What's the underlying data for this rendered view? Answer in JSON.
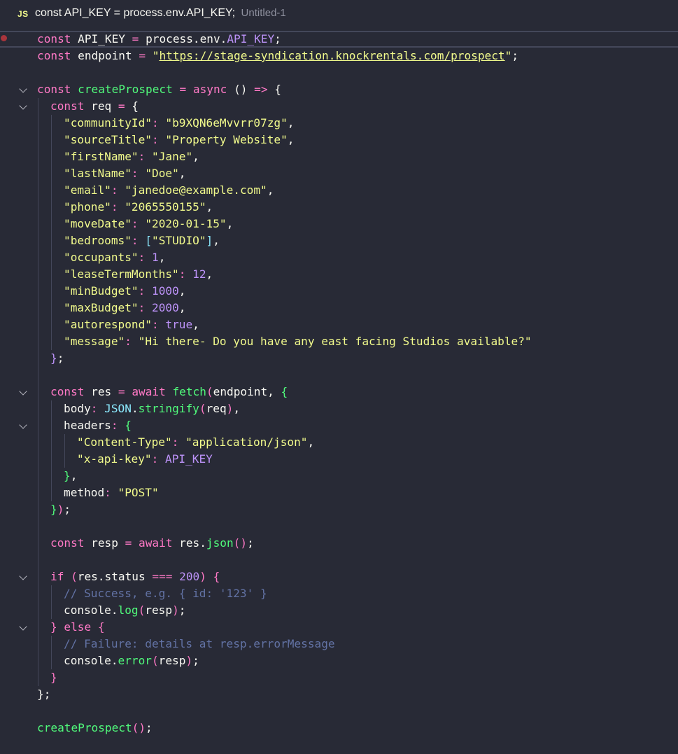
{
  "tab": {
    "badge": "JS",
    "title": "const API_KEY = process.env.API_KEY;",
    "filename": "Untitled-1"
  },
  "colors": {
    "background": "#282a36",
    "keyword": "#ff79c6",
    "string": "#f1fa8c",
    "function": "#50fa7b",
    "number": "#bd93f9",
    "comment": "#6272a4",
    "foreground": "#f8f8f2",
    "breakpoint": "#a9353c"
  },
  "editor": {
    "lines": [
      {
        "fold": false,
        "current": true,
        "indent": 0,
        "tokens": [
          [
            "k",
            "const"
          ],
          [
            "w",
            " API_KEY "
          ],
          [
            "k",
            "="
          ],
          [
            "w",
            " process.env."
          ],
          [
            "v",
            "API_KEY"
          ],
          [
            "w",
            ";"
          ]
        ]
      },
      {
        "fold": false,
        "indent": 0,
        "tokens": [
          [
            "k",
            "const"
          ],
          [
            "w",
            " endpoint "
          ],
          [
            "k",
            "="
          ],
          [
            "w",
            " "
          ],
          [
            "s",
            "\""
          ],
          [
            "u",
            "https://stage-syndication.knockrentals.com/prospect"
          ],
          [
            "s",
            "\""
          ],
          [
            "w",
            ";"
          ]
        ]
      },
      {
        "fold": false,
        "indent": 0,
        "tokens": []
      },
      {
        "fold": true,
        "indent": 0,
        "tokens": [
          [
            "k",
            "const"
          ],
          [
            "w",
            " "
          ],
          [
            "f",
            "createProspect"
          ],
          [
            "w",
            " "
          ],
          [
            "k",
            "="
          ],
          [
            "w",
            " "
          ],
          [
            "k",
            "async"
          ],
          [
            "w",
            " () "
          ],
          [
            "k",
            "=>"
          ],
          [
            "w",
            " {"
          ]
        ]
      },
      {
        "fold": true,
        "indent": 1,
        "tokens": [
          [
            "k",
            "const"
          ],
          [
            "w",
            " req "
          ],
          [
            "k",
            "="
          ],
          [
            "w",
            " {"
          ]
        ]
      },
      {
        "fold": false,
        "indent": 2,
        "tokens": [
          [
            "s",
            "\"communityId\""
          ],
          [
            "k",
            ":"
          ],
          [
            "w",
            " "
          ],
          [
            "s",
            "\"b9XQN6eMvvrr07zg\""
          ],
          [
            "w",
            ","
          ]
        ]
      },
      {
        "fold": false,
        "indent": 2,
        "tokens": [
          [
            "s",
            "\"sourceTitle\""
          ],
          [
            "k",
            ":"
          ],
          [
            "w",
            " "
          ],
          [
            "s",
            "\"Property Website\""
          ],
          [
            "w",
            ","
          ]
        ]
      },
      {
        "fold": false,
        "indent": 2,
        "tokens": [
          [
            "s",
            "\"firstName\""
          ],
          [
            "k",
            ":"
          ],
          [
            "w",
            " "
          ],
          [
            "s",
            "\"Jane\""
          ],
          [
            "w",
            ","
          ]
        ]
      },
      {
        "fold": false,
        "indent": 2,
        "tokens": [
          [
            "s",
            "\"lastName\""
          ],
          [
            "k",
            ":"
          ],
          [
            "w",
            " "
          ],
          [
            "s",
            "\"Doe\""
          ],
          [
            "w",
            ","
          ]
        ]
      },
      {
        "fold": false,
        "indent": 2,
        "tokens": [
          [
            "s",
            "\"email\""
          ],
          [
            "k",
            ":"
          ],
          [
            "w",
            " "
          ],
          [
            "s",
            "\"janedoe@example.com\""
          ],
          [
            "w",
            ","
          ]
        ]
      },
      {
        "fold": false,
        "indent": 2,
        "tokens": [
          [
            "s",
            "\"phone\""
          ],
          [
            "k",
            ":"
          ],
          [
            "w",
            " "
          ],
          [
            "s",
            "\"2065550155\""
          ],
          [
            "w",
            ","
          ]
        ]
      },
      {
        "fold": false,
        "indent": 2,
        "tokens": [
          [
            "s",
            "\"moveDate\""
          ],
          [
            "k",
            ":"
          ],
          [
            "w",
            " "
          ],
          [
            "s",
            "\"2020-01-15\""
          ],
          [
            "w",
            ","
          ]
        ]
      },
      {
        "fold": false,
        "indent": 2,
        "tokens": [
          [
            "s",
            "\"bedrooms\""
          ],
          [
            "k",
            ":"
          ],
          [
            "w",
            " "
          ],
          [
            "cy",
            "["
          ],
          [
            "s",
            "\"STUDIO\""
          ],
          [
            "cy",
            "]"
          ],
          [
            "w",
            ","
          ]
        ]
      },
      {
        "fold": false,
        "indent": 2,
        "tokens": [
          [
            "s",
            "\"occupants\""
          ],
          [
            "k",
            ":"
          ],
          [
            "w",
            " "
          ],
          [
            "v",
            "1"
          ],
          [
            "w",
            ","
          ]
        ]
      },
      {
        "fold": false,
        "indent": 2,
        "tokens": [
          [
            "s",
            "\"leaseTermMonths\""
          ],
          [
            "k",
            ":"
          ],
          [
            "w",
            " "
          ],
          [
            "v",
            "12"
          ],
          [
            "w",
            ","
          ]
        ]
      },
      {
        "fold": false,
        "indent": 2,
        "tokens": [
          [
            "s",
            "\"minBudget\""
          ],
          [
            "k",
            ":"
          ],
          [
            "w",
            " "
          ],
          [
            "v",
            "1000"
          ],
          [
            "w",
            ","
          ]
        ]
      },
      {
        "fold": false,
        "indent": 2,
        "tokens": [
          [
            "s",
            "\"maxBudget\""
          ],
          [
            "k",
            ":"
          ],
          [
            "w",
            " "
          ],
          [
            "v",
            "2000"
          ],
          [
            "w",
            ","
          ]
        ]
      },
      {
        "fold": false,
        "indent": 2,
        "tokens": [
          [
            "s",
            "\"autorespond\""
          ],
          [
            "k",
            ":"
          ],
          [
            "w",
            " "
          ],
          [
            "v",
            "true"
          ],
          [
            "w",
            ","
          ]
        ]
      },
      {
        "fold": false,
        "indent": 2,
        "tokens": [
          [
            "s",
            "\"message\""
          ],
          [
            "k",
            ":"
          ],
          [
            "w",
            " "
          ],
          [
            "s",
            "\"Hi there- Do you have any east facing Studios available?\""
          ]
        ]
      },
      {
        "fold": false,
        "indent": 1,
        "tokens": [
          [
            "v",
            "}"
          ],
          [
            "w",
            ";"
          ]
        ]
      },
      {
        "fold": false,
        "indent": 1,
        "tokens": []
      },
      {
        "fold": true,
        "indent": 1,
        "tokens": [
          [
            "k",
            "const"
          ],
          [
            "w",
            " res "
          ],
          [
            "k",
            "="
          ],
          [
            "w",
            " "
          ],
          [
            "k",
            "await"
          ],
          [
            "w",
            " "
          ],
          [
            "f",
            "fetch"
          ],
          [
            "k",
            "("
          ],
          [
            "w",
            "endpoint, "
          ],
          [
            "f",
            "{"
          ]
        ]
      },
      {
        "fold": false,
        "indent": 2,
        "tokens": [
          [
            "w",
            "body"
          ],
          [
            "k",
            ":"
          ],
          [
            "w",
            " "
          ],
          [
            "cy",
            "JSON"
          ],
          [
            "w",
            "."
          ],
          [
            "f",
            "stringify"
          ],
          [
            "k",
            "("
          ],
          [
            "w",
            "req"
          ],
          [
            "k",
            ")"
          ],
          [
            "w",
            ","
          ]
        ]
      },
      {
        "fold": true,
        "indent": 2,
        "tokens": [
          [
            "w",
            "headers"
          ],
          [
            "k",
            ":"
          ],
          [
            "w",
            " "
          ],
          [
            "f",
            "{"
          ]
        ]
      },
      {
        "fold": false,
        "indent": 3,
        "tokens": [
          [
            "s",
            "\"Content-Type\""
          ],
          [
            "k",
            ":"
          ],
          [
            "w",
            " "
          ],
          [
            "s",
            "\"application/json\""
          ],
          [
            "w",
            ","
          ]
        ]
      },
      {
        "fold": false,
        "indent": 3,
        "tokens": [
          [
            "s",
            "\"x-api-key\""
          ],
          [
            "k",
            ":"
          ],
          [
            "w",
            " "
          ],
          [
            "v",
            "API_KEY"
          ]
        ]
      },
      {
        "fold": false,
        "indent": 2,
        "tokens": [
          [
            "f",
            "}"
          ],
          [
            "w",
            ","
          ]
        ]
      },
      {
        "fold": false,
        "indent": 2,
        "tokens": [
          [
            "w",
            "method"
          ],
          [
            "k",
            ":"
          ],
          [
            "w",
            " "
          ],
          [
            "s",
            "\"POST\""
          ]
        ]
      },
      {
        "fold": false,
        "indent": 1,
        "tokens": [
          [
            "f",
            "}"
          ],
          [
            "k",
            ")"
          ],
          [
            "w",
            ";"
          ]
        ]
      },
      {
        "fold": false,
        "indent": 1,
        "tokens": []
      },
      {
        "fold": false,
        "indent": 1,
        "tokens": [
          [
            "k",
            "const"
          ],
          [
            "w",
            " resp "
          ],
          [
            "k",
            "="
          ],
          [
            "w",
            " "
          ],
          [
            "k",
            "await"
          ],
          [
            "w",
            " res."
          ],
          [
            "f",
            "json"
          ],
          [
            "k",
            "()"
          ],
          [
            "w",
            ";"
          ]
        ]
      },
      {
        "fold": false,
        "indent": 1,
        "tokens": []
      },
      {
        "fold": true,
        "indent": 1,
        "tokens": [
          [
            "k",
            "if"
          ],
          [
            "w",
            " "
          ],
          [
            "k",
            "("
          ],
          [
            "w",
            "res.status "
          ],
          [
            "k",
            "==="
          ],
          [
            "w",
            " "
          ],
          [
            "v",
            "200"
          ],
          [
            "k",
            ")"
          ],
          [
            "w",
            " "
          ],
          [
            "k",
            "{"
          ]
        ]
      },
      {
        "fold": false,
        "indent": 2,
        "tokens": [
          [
            "c",
            "// Success, e.g. { id: '123' }"
          ]
        ]
      },
      {
        "fold": false,
        "indent": 2,
        "tokens": [
          [
            "w",
            "console."
          ],
          [
            "f",
            "log"
          ],
          [
            "k",
            "("
          ],
          [
            "w",
            "resp"
          ],
          [
            "k",
            ")"
          ],
          [
            "w",
            ";"
          ]
        ]
      },
      {
        "fold": true,
        "indent": 1,
        "tokens": [
          [
            "k",
            "}"
          ],
          [
            "w",
            " "
          ],
          [
            "k",
            "else"
          ],
          [
            "w",
            " "
          ],
          [
            "k",
            "{"
          ]
        ]
      },
      {
        "fold": false,
        "indent": 2,
        "tokens": [
          [
            "c",
            "// Failure: details at resp.errorMessage"
          ]
        ]
      },
      {
        "fold": false,
        "indent": 2,
        "tokens": [
          [
            "w",
            "console."
          ],
          [
            "f",
            "error"
          ],
          [
            "k",
            "("
          ],
          [
            "w",
            "resp"
          ],
          [
            "k",
            ")"
          ],
          [
            "w",
            ";"
          ]
        ]
      },
      {
        "fold": false,
        "indent": 1,
        "tokens": [
          [
            "k",
            "}"
          ]
        ]
      },
      {
        "fold": false,
        "indent": 0,
        "tokens": [
          [
            "w",
            "};"
          ]
        ]
      },
      {
        "fold": false,
        "indent": 0,
        "tokens": []
      },
      {
        "fold": false,
        "indent": 0,
        "tokens": [
          [
            "f",
            "createProspect"
          ],
          [
            "k",
            "()"
          ],
          [
            "w",
            ";"
          ]
        ]
      }
    ]
  }
}
